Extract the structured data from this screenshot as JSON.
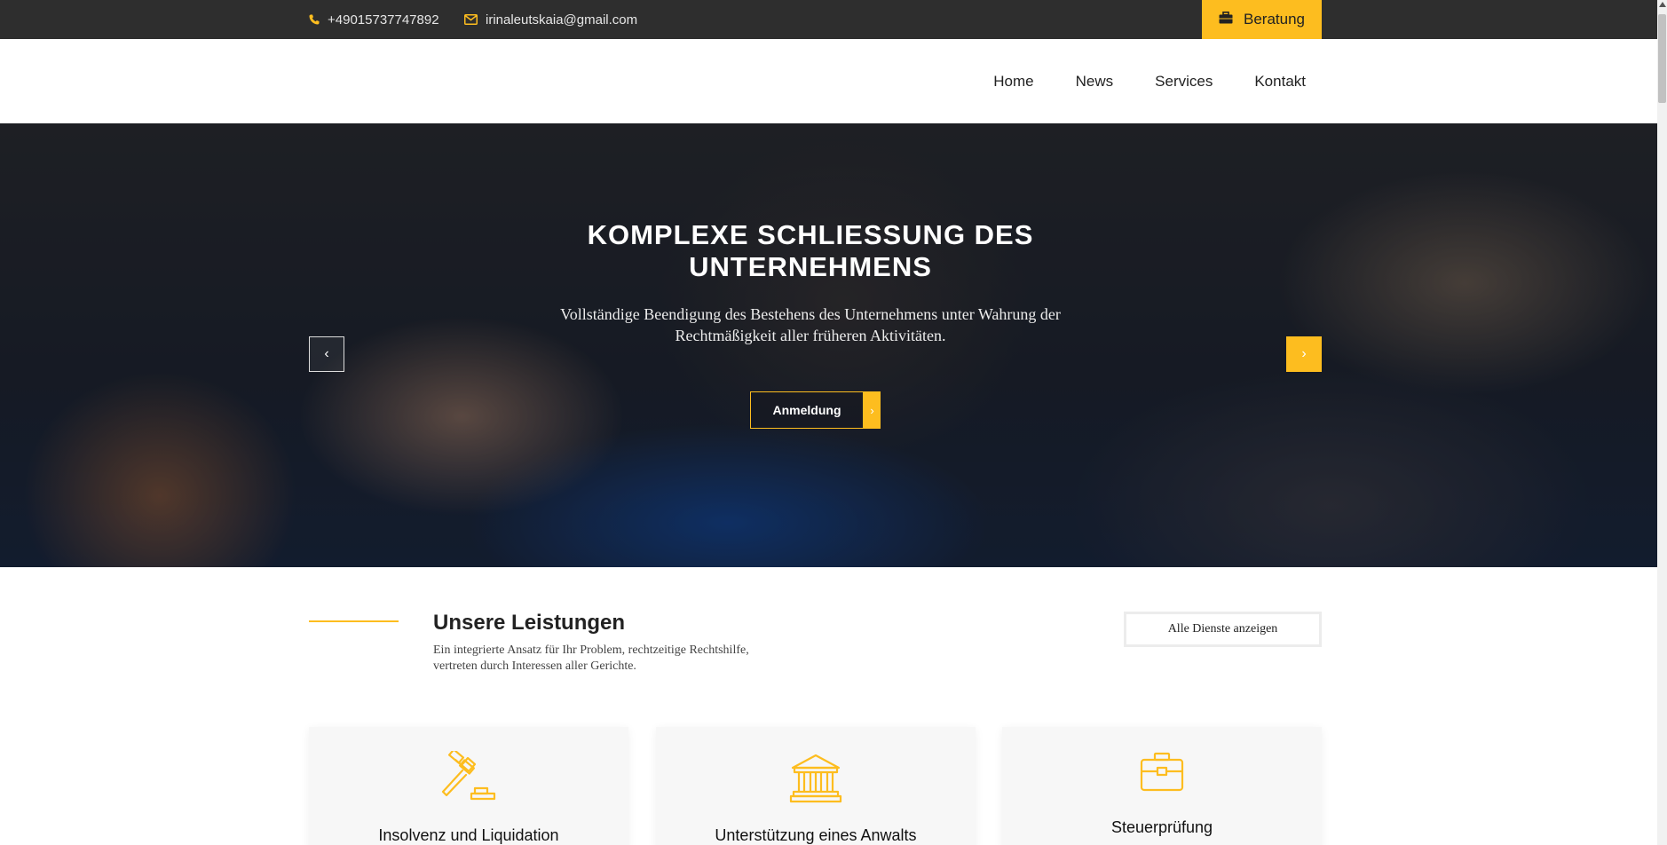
{
  "topbar": {
    "phone": "+49015737747892",
    "email": "irinaleutskaia@gmail.com",
    "consult_button": "Beratung"
  },
  "nav": {
    "items": [
      "Home",
      "News",
      "Services",
      "Kontakt"
    ]
  },
  "hero": {
    "title": "KOMPLEXE SCHLIESSUNG DES UNTERNEHMENS",
    "subtitle": "Vollständige Beendigung des Bestehens des Unternehmens unter Wahrung der Rechtmäßigkeit aller früheren Aktivitäten.",
    "cta": "Anmeldung",
    "prev_arrow": "‹",
    "next_arrow": "›"
  },
  "services": {
    "title": "Unsere Leistungen",
    "description": "Ein integrierte Ansatz für Ihr Problem, rechtzeitige Rechtshilfe, vertreten durch Interessen aller Gerichte.",
    "all_button": "Alle Dienste anzeigen",
    "cards": [
      {
        "title": "Insolvenz und Liquidation",
        "icon": "gavel-icon"
      },
      {
        "title": "Unterstützung eines Anwalts",
        "icon": "courthouse-icon"
      },
      {
        "title": "Steuerprüfung",
        "icon": "briefcase-icon"
      }
    ]
  },
  "colors": {
    "accent": "#fdbd1f",
    "topbar": "#2e2e2e"
  }
}
